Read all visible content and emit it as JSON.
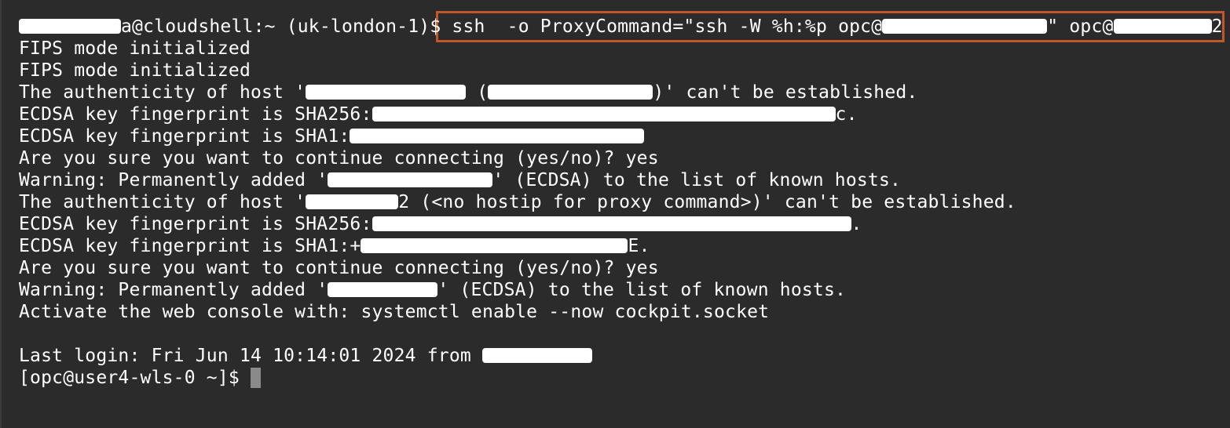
{
  "terminal": {
    "lines": [
      {
        "segments": [
          {
            "t": "text",
            "v": "a@cloudshell:~ (uk-london-1)$ "
          },
          {
            "t": "text",
            "v": "ssh  -o ProxyCommand=\"ssh -W %h:%p opc@"
          },
          {
            "t": "text",
            "v": "\" opc@"
          },
          {
            "t": "text",
            "v": "2"
          }
        ]
      },
      {
        "segments": [
          {
            "t": "text",
            "v": "FIPS mode initialized"
          }
        ]
      },
      {
        "segments": [
          {
            "t": "text",
            "v": "FIPS mode initialized"
          }
        ]
      },
      {
        "segments": [
          {
            "t": "text",
            "v": "The authenticity of host '"
          },
          {
            "t": "text",
            "v": " ("
          },
          {
            "t": "text",
            "v": ")' can't be established."
          }
        ]
      },
      {
        "segments": [
          {
            "t": "text",
            "v": "ECDSA key fingerprint is SHA256:"
          },
          {
            "t": "text",
            "v": "c."
          }
        ]
      },
      {
        "segments": [
          {
            "t": "text",
            "v": "ECDSA key fingerprint is SHA1:"
          }
        ]
      },
      {
        "segments": [
          {
            "t": "text",
            "v": "Are you sure you want to continue connecting (yes/no)? yes"
          }
        ]
      },
      {
        "segments": [
          {
            "t": "text",
            "v": "Warning: Permanently added '"
          },
          {
            "t": "text",
            "v": "' (ECDSA) to the list of known hosts."
          }
        ]
      },
      {
        "segments": [
          {
            "t": "text",
            "v": "The authenticity of host '"
          },
          {
            "t": "text",
            "v": "2 (<no hostip for proxy command>)' can't be established."
          }
        ]
      },
      {
        "segments": [
          {
            "t": "text",
            "v": "ECDSA key fingerprint is SHA256:"
          },
          {
            "t": "text",
            "v": "."
          }
        ]
      },
      {
        "segments": [
          {
            "t": "text",
            "v": "ECDSA key fingerprint is SHA1:"
          },
          {
            "t": "text",
            "v": "+"
          },
          {
            "t": "text",
            "v": "E."
          }
        ]
      },
      {
        "segments": [
          {
            "t": "text",
            "v": "Are you sure you want to continue connecting (yes/no)? yes"
          }
        ]
      },
      {
        "segments": [
          {
            "t": "text",
            "v": "Warning: Permanently added '"
          },
          {
            "t": "text",
            "v": "' (ECDSA) to the list of known hosts."
          }
        ]
      },
      {
        "segments": [
          {
            "t": "text",
            "v": "Activate the web console with: systemctl enable --now cockpit.socket"
          }
        ]
      },
      {
        "segments": [
          {
            "t": "text",
            "v": ""
          }
        ]
      },
      {
        "segments": [
          {
            "t": "text",
            "v": "Last login: Fri Jun 14 10:14:01 2024 from "
          }
        ]
      },
      {
        "segments": [
          {
            "t": "text",
            "v": "[opc@user4-wls-0 ~]$ "
          }
        ]
      }
    ]
  },
  "colors": {
    "background": "#2b2b2b",
    "text": "#ffffff",
    "highlight_border": "#c0562a",
    "cursor": "#8a8a8a"
  }
}
